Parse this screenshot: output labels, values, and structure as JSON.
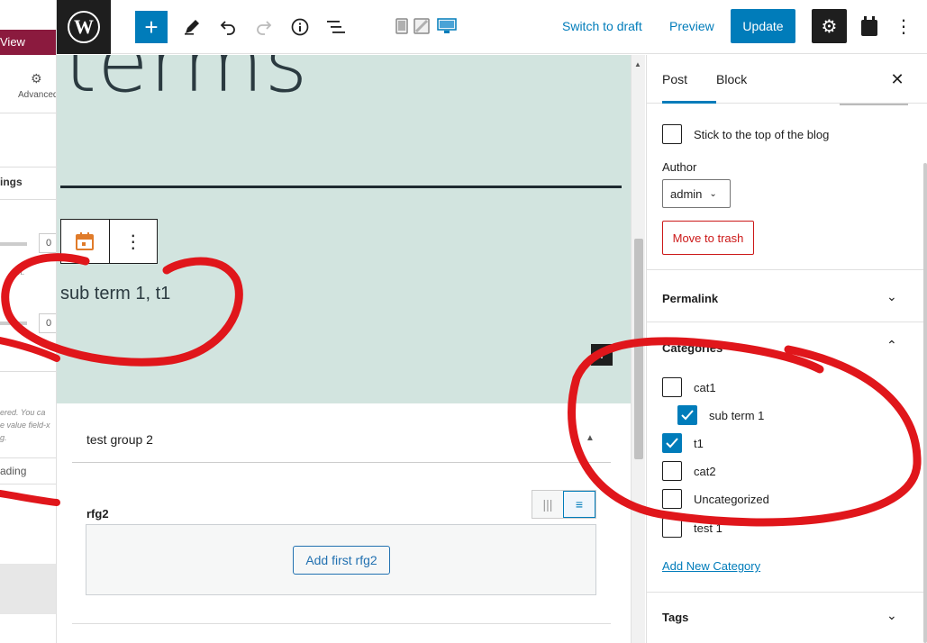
{
  "left_strip": {
    "view_label": "View",
    "advanced_label": "Advanced",
    "settings_label": "ings",
    "num_1": "0",
    "num_2": "0",
    "small_text_1": "ft.",
    "small_text_2": "ered. You ca",
    "small_text_3": "e value field-x",
    "small_text_4": "g.",
    "heading_label": "ading"
  },
  "toolbar": {
    "inserter_icon": "plus-icon",
    "switch_to_draft": "Switch to draft",
    "preview": "Preview",
    "update": "Update"
  },
  "canvas": {
    "big_title": "terms",
    "terms_text": "sub term 1, t1",
    "group_title": "test group 2",
    "rfg_label": "rfg2",
    "add_first": "Add first rfg2"
  },
  "sidebar": {
    "tabs": [
      {
        "label": "Post",
        "active": true
      },
      {
        "label": "Block",
        "active": false
      }
    ],
    "sticky_label": "Stick to the top of the blog",
    "author_label": "Author",
    "author_value": "admin",
    "trash_label": "Move to trash",
    "permalink_label": "Permalink",
    "categories_label": "Categories",
    "categories": [
      {
        "label": "cat1",
        "checked": false,
        "indent": false
      },
      {
        "label": "sub term 1",
        "checked": true,
        "indent": true
      },
      {
        "label": "t1",
        "checked": true,
        "indent": false
      },
      {
        "label": "cat2",
        "checked": false,
        "indent": false
      },
      {
        "label": "Uncategorized",
        "checked": false,
        "indent": false
      },
      {
        "label": "test 1",
        "checked": false,
        "indent": false
      }
    ],
    "add_category": "Add New Category",
    "tags_label": "Tags"
  },
  "colors": {
    "accent": "#007cba",
    "cover_bg": "#d2e4df",
    "danger": "#cc1818",
    "annotation": "#e0161b"
  }
}
